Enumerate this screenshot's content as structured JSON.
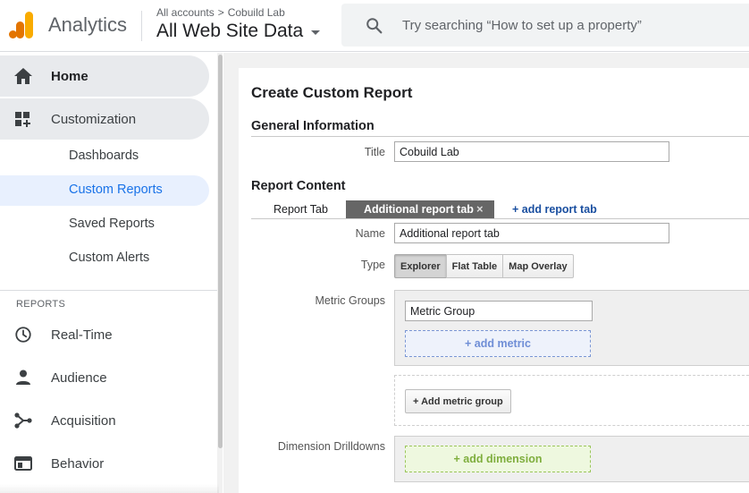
{
  "header": {
    "app_name": "Analytics",
    "breadcrumb_account": "All accounts",
    "breadcrumb_separator": ">",
    "breadcrumb_property": "Cobuild Lab",
    "view_name": "All Web Site Data",
    "search_placeholder": "Try searching “How to set up a property”"
  },
  "sidebar": {
    "home": "Home",
    "customization": "Customization",
    "sub_items": [
      "Dashboards",
      "Custom Reports",
      "Saved Reports",
      "Custom Alerts"
    ],
    "selected_sub": "Custom Reports",
    "reports_heading": "REPORTS",
    "reports": [
      "Real-Time",
      "Audience",
      "Acquisition",
      "Behavior"
    ]
  },
  "form": {
    "page_title": "Create Custom Report",
    "general_heading": "General Information",
    "title_label": "Title",
    "title_value": "Cobuild Lab",
    "content_heading": "Report Content",
    "report_tab_label": "Report Tab",
    "active_tab": "Additional report tab",
    "close_glyph": "×",
    "add_tab": "+ add report tab",
    "name_label": "Name",
    "name_value": "Additional report tab",
    "type_label": "Type",
    "types": [
      "Explorer",
      "Flat Table",
      "Map Overlay"
    ],
    "selected_type": "Explorer",
    "metric_groups_label": "Metric Groups",
    "metric_group_value": "Metric Group",
    "add_metric": "+ add metric",
    "add_metric_group": "+ Add metric group",
    "dimension_label": "Dimension Drilldowns",
    "add_dimension": "+ add dimension"
  },
  "colors": {
    "accent_blue": "#1a73e8",
    "active_tab_bg": "#666666",
    "ga_orange": "#f9ab00",
    "ga_orange_dark": "#e37400"
  },
  "icons": {
    "logo": "analytics-logo",
    "search": "search-icon",
    "home": "home-icon",
    "customization": "dashboard-customization-icon",
    "realtime": "clock-icon",
    "audience": "person-icon",
    "acquisition": "acquisition-icon",
    "behavior": "behavior-window-icon"
  }
}
